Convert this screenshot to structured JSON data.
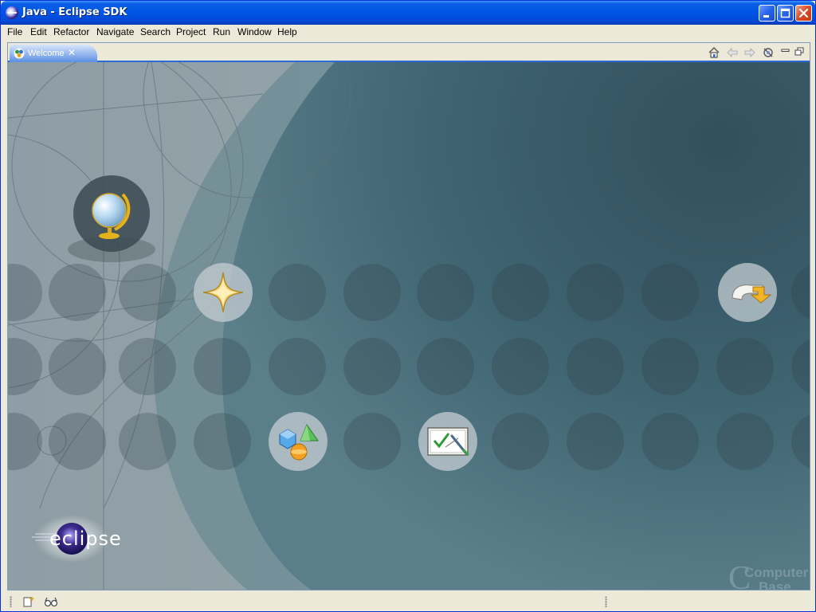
{
  "window": {
    "title": "Java - Eclipse SDK"
  },
  "menubar": {
    "items": [
      "File",
      "Edit",
      "Refactor",
      "Navigate",
      "Search",
      "Project",
      "Run",
      "Window",
      "Help"
    ]
  },
  "editor": {
    "tab_label": "Welcome",
    "toolbar_icons": [
      "home-icon",
      "back-icon",
      "forward-icon",
      "customize-icon",
      "minimize-view-icon",
      "maximize-view-icon"
    ]
  },
  "welcome": {
    "items": [
      "overview-icon",
      "whats-new-icon",
      "samples-icon",
      "tutorials-icon",
      "workbench-icon"
    ],
    "logo_text": "eclipse"
  },
  "watermark": {
    "line1": "Computer",
    "line2": "Base"
  },
  "colors": {
    "titlebar": "#0055e5",
    "tab_active": "#5b8fe3",
    "welcome_bg": "#3e5f6d"
  }
}
